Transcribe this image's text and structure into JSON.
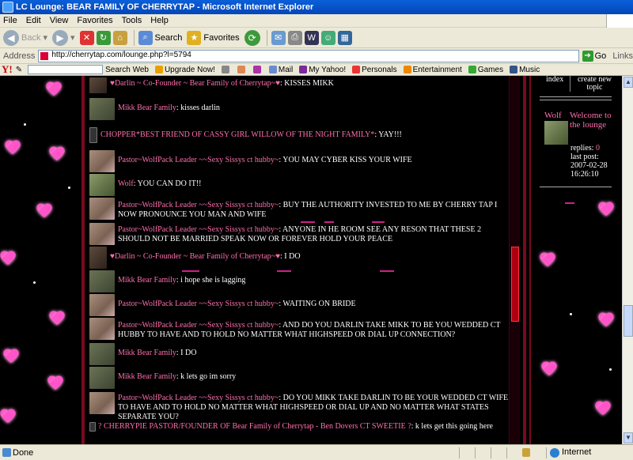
{
  "window": {
    "title": "LC Lounge: BEAR FAMILY OF CHERRYTAP - Microsoft Internet Explorer"
  },
  "menu": [
    "File",
    "Edit",
    "View",
    "Favorites",
    "Tools",
    "Help"
  ],
  "toolbar": {
    "back": "Back",
    "search": "Search",
    "favorites": "Favorites"
  },
  "address": {
    "label": "Address",
    "url": "http://cherrytap.com/lounge.php?l=5794",
    "go": "Go",
    "links": "Links"
  },
  "yahoo": {
    "logo": "Y!",
    "search_web": "Search Web",
    "upgrade": "Upgrade Now!",
    "mail": "Mail",
    "my_yahoo": "My Yahoo!",
    "personals": "Personals",
    "entertainment": "Entertainment",
    "games": "Games",
    "music": "Music"
  },
  "chat": {
    "messages": [
      {
        "user": "♥Darlin ~ Co-Founder ~ Bear Family of Cherrytap~♥",
        "text": ": KISSES MIKK"
      },
      {
        "user": "Mikk Bear Family",
        "text": ": kisses darlin"
      },
      {
        "user": "CHOPPER*BEST FRIEND OF CASSY GIRL WILLOW OF THE NIGHT FAMILY*",
        "text": ": YAY!!!"
      },
      {
        "user": "Pastor~WolfPack Leader ~~Sexy Sissys ct hubby~",
        "text": ": YOU MAY CYBER KISS YOUR WIFE"
      },
      {
        "user": "Wolf",
        "text": ": YOU CAN DO IT!!"
      },
      {
        "user": "Pastor~WolfPack Leader ~~Sexy Sissys ct hubby~",
        "text": ": BUY THE AUTHORITY INVESTED TO ME BY CHERRY TAP I NOW PRONOUNCE YOU MAN AND WIFE"
      },
      {
        "user": "Pastor~WolfPack Leader ~~Sexy Sissys ct hubby~",
        "text": ": ANYONE IN HE ROOM SEE ANY RESON THAT THESE 2 SHOULD NOT BE MARRIED SPEAK NOW OR FOREVER HOLD YOUR PEACE"
      },
      {
        "user": "♥Darlin ~ Co-Founder ~ Bear Family of Cherrytap~♥",
        "text": ": I DO"
      },
      {
        "user": "Mikk Bear Family",
        "text": ": i hope she is lagging"
      },
      {
        "user": "Pastor~WolfPack Leader ~~Sexy Sissys ct hubby~",
        "text": ": WAITING ON BRIDE"
      },
      {
        "user": "Pastor~WolfPack Leader ~~Sexy Sissys ct hubby~",
        "text": ": AND DO YOU DARLIN TAKE MIKK TO BE YOU WEDDED CT HUBBY TO HAVE AND TO HOLD NO MATTER WHAT HIGHSPEED OR DIAL UP CONNECTION?"
      },
      {
        "user": "Mikk Bear Family",
        "text": ": I DO"
      },
      {
        "user": "Mikk Bear Family",
        "text": ": k lets go im sorry"
      },
      {
        "user": "Pastor~WolfPack Leader ~~Sexy Sissys ct hubby~",
        "text": ": DO YOU MIKK TAKE DARLIN TO BE YOUR WEDDED CT WIFE TO HAVE AND TO HOLD NO MATTER WHAT HIGHSPEED OR DIAL UP AND NO MATTER WHAT STATES SEPARATE YOU?"
      },
      {
        "user": "? CHERRYPIE PASTOR/FOUNDER OF Bear Family of Cherrytap - Ben Dovers CT SWEETIE ?",
        "text": ": k lets get this going here"
      }
    ]
  },
  "sidebar": {
    "index": "index",
    "create": "create new topic",
    "user": "Wolf",
    "welcome": "Welcome to the lounge",
    "replies_label": "replies:",
    "replies": "0",
    "last_post_label": "last post:",
    "last_post": "2007-02-28 16:26:10"
  },
  "status": {
    "text": "Done",
    "zone": "Internet"
  }
}
